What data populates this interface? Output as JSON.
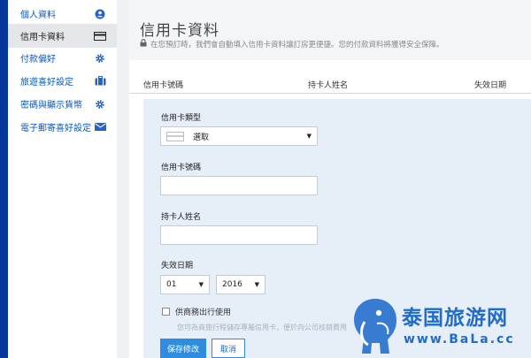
{
  "sidebar": {
    "items": [
      {
        "label": "個人資料",
        "icon": "user-circle-icon",
        "active": false
      },
      {
        "label": "信用卡資料",
        "icon": "credit-card-icon",
        "active": true
      },
      {
        "label": "付款偏好",
        "icon": "gear-icon",
        "active": false
      },
      {
        "label": "旅遊喜好設定",
        "icon": "suitcase-icon",
        "active": false
      },
      {
        "label": "密碼與顯示貨幣",
        "icon": "gear-icon",
        "active": false
      },
      {
        "label": "電子郵寄喜好設定",
        "icon": "envelope-icon",
        "active": false
      }
    ]
  },
  "header": {
    "title": "信用卡資料",
    "subtitle": "在您預訂時，我們會自動填入信用卡資料讓訂房更便捷。您的付款資料將獲得安全保障。"
  },
  "table": {
    "columns": [
      "信用卡號碼",
      "持卡人姓名",
      "失效日期"
    ]
  },
  "form": {
    "card_type_label": "信用卡類型",
    "card_type_value": "選取",
    "card_number_label": "信用卡號碼",
    "card_number_value": "",
    "holder_label": "持卡人姓名",
    "holder_value": "",
    "expiry_label": "失效日期",
    "expiry_month": "01",
    "expiry_year": "2016",
    "business_label": "供商務出行使用",
    "business_checked": false,
    "business_hint": "您可為商旅行程儲存專屬信用卡，便於向公司核銷費用",
    "save_label": "保存修改",
    "cancel_label": "取消"
  },
  "watermark": {
    "text": "泰国旅游网",
    "url": "www.BaLa.cc"
  },
  "colors": {
    "sidebar_bar": "#06369a",
    "link": "#0a58b8",
    "panel": "#e6eef8",
    "primary_button": "#2e8de0",
    "watermark": "#1f6cc9"
  }
}
